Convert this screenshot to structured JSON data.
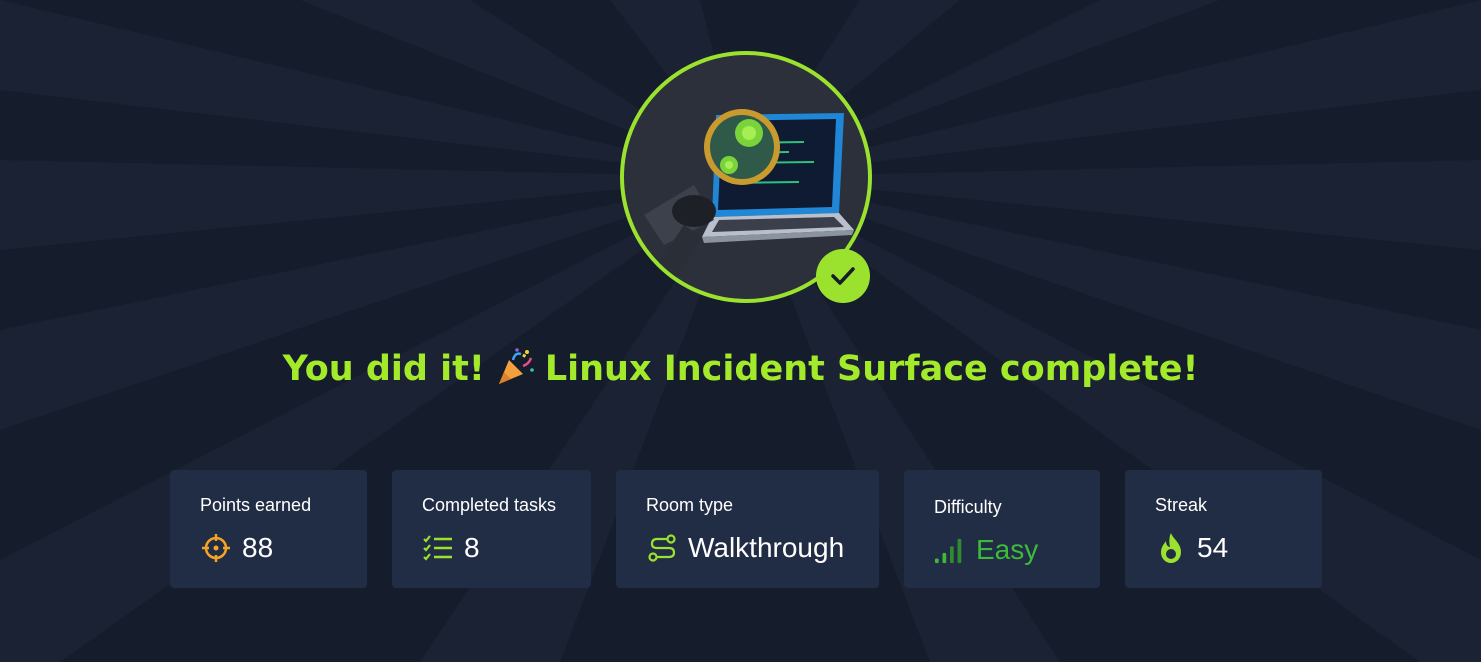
{
  "headline": {
    "prefix": "You did it!",
    "room_name": "Linux Incident Surface complete!"
  },
  "stats": [
    {
      "label": "Points earned",
      "value": "88",
      "icon": "target-icon",
      "icon_color": "#f5a524"
    },
    {
      "label": "Completed tasks",
      "value": "8",
      "icon": "checklist-icon",
      "icon_color": "#9be22e"
    },
    {
      "label": "Room type",
      "value": "Walkthrough",
      "icon": "route-icon",
      "icon_color": "#9be22e"
    },
    {
      "label": "Difficulty",
      "value": "Easy",
      "icon": "signal-bars-icon",
      "icon_color": "#3dba3a"
    },
    {
      "label": "Streak",
      "value": "54",
      "icon": "flame-icon",
      "icon_color": "#9be22e"
    }
  ],
  "colors": {
    "background": "#151c2b",
    "accent": "#a3ea2a",
    "card": "#212c45",
    "easy": "#3dba3a",
    "points_icon": "#f5a524"
  }
}
